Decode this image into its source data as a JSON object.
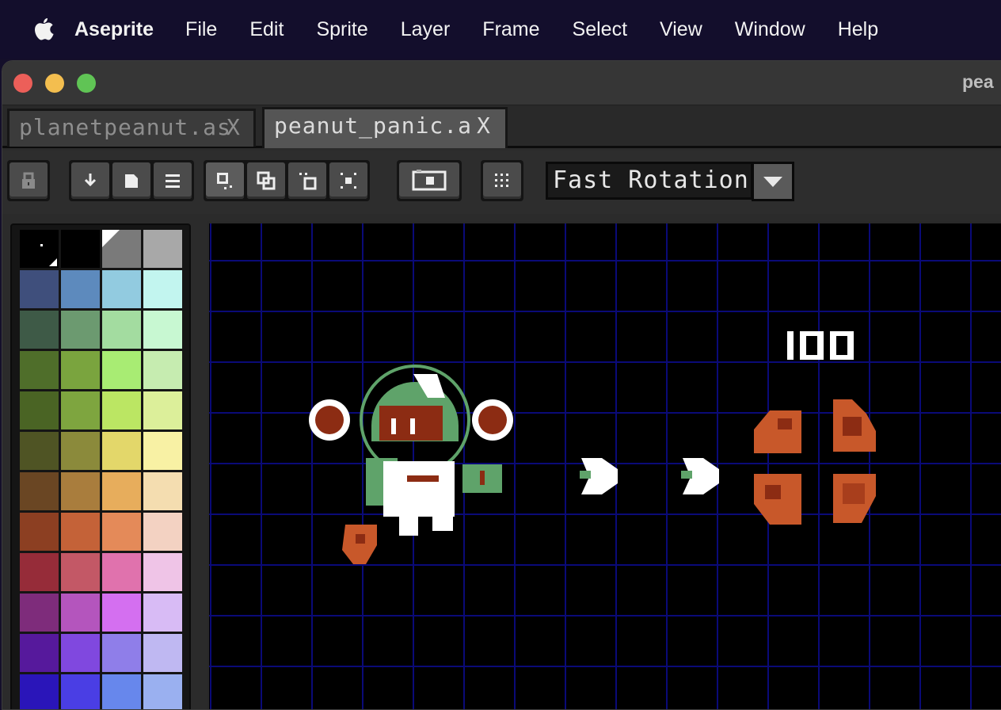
{
  "menubar": {
    "app_name": "Aseprite",
    "items": [
      "File",
      "Edit",
      "Sprite",
      "Layer",
      "Frame",
      "Select",
      "View",
      "Window",
      "Help"
    ]
  },
  "window": {
    "title": "pea",
    "traffic_lights": {
      "close": "#ec5f59",
      "minimize": "#f3be4f",
      "zoom": "#60c455"
    }
  },
  "tabs": [
    {
      "label": "planetpeanut.as",
      "close": "X",
      "active": false
    },
    {
      "label": "peanut_panic.a",
      "close": "X",
      "active": true
    }
  ],
  "toolbar": {
    "icons": [
      "lock-icon",
      "merge-down-icon",
      "new-layer-icon",
      "menu-icon",
      "select-rect-icon",
      "select-add-icon",
      "select-subtract-icon",
      "select-intersect-icon",
      "preview-icon",
      "pixel-grid-icon"
    ],
    "rotation_algorithm": "Fast Rotation"
  },
  "palette": {
    "colors": [
      "#000000",
      "#000000",
      "#7a7a7a",
      "#a8a8a8",
      "#3f4f7c",
      "#5d8abd",
      "#92cbe0",
      "#c2f5ef",
      "#3e5a47",
      "#6c9a70",
      "#a3dca0",
      "#c8f8d2",
      "#4f6e2a",
      "#7aa43e",
      "#a8ec73",
      "#c6ecb0",
      "#4a6424",
      "#7ea53f",
      "#bbe663",
      "#dcef9a",
      "#4f5424",
      "#8b8a3b",
      "#e3d76a",
      "#f8f1a4",
      "#6a4623",
      "#a97d3d",
      "#e7ad5c",
      "#f4ddb0",
      "#8c3f22",
      "#c46238",
      "#e48a59",
      "#f3d2c2",
      "#962c39",
      "#c35866",
      "#e072ad",
      "#efc4e7",
      "#7e2c7b",
      "#b455bd",
      "#d46ff0",
      "#d8bbf5",
      "#56199c",
      "#8048df",
      "#8f7ee9",
      "#bfb8f2",
      "#2a15b9",
      "#4a3ee4",
      "#6787ec",
      "#9ab0f0"
    ]
  },
  "canvas": {
    "background": "#000000",
    "grid_color": "#0a0a78",
    "score": "100",
    "accent_orange": "#c8582a",
    "accent_green": "#5fa36a",
    "brown": "#8c2c13"
  }
}
